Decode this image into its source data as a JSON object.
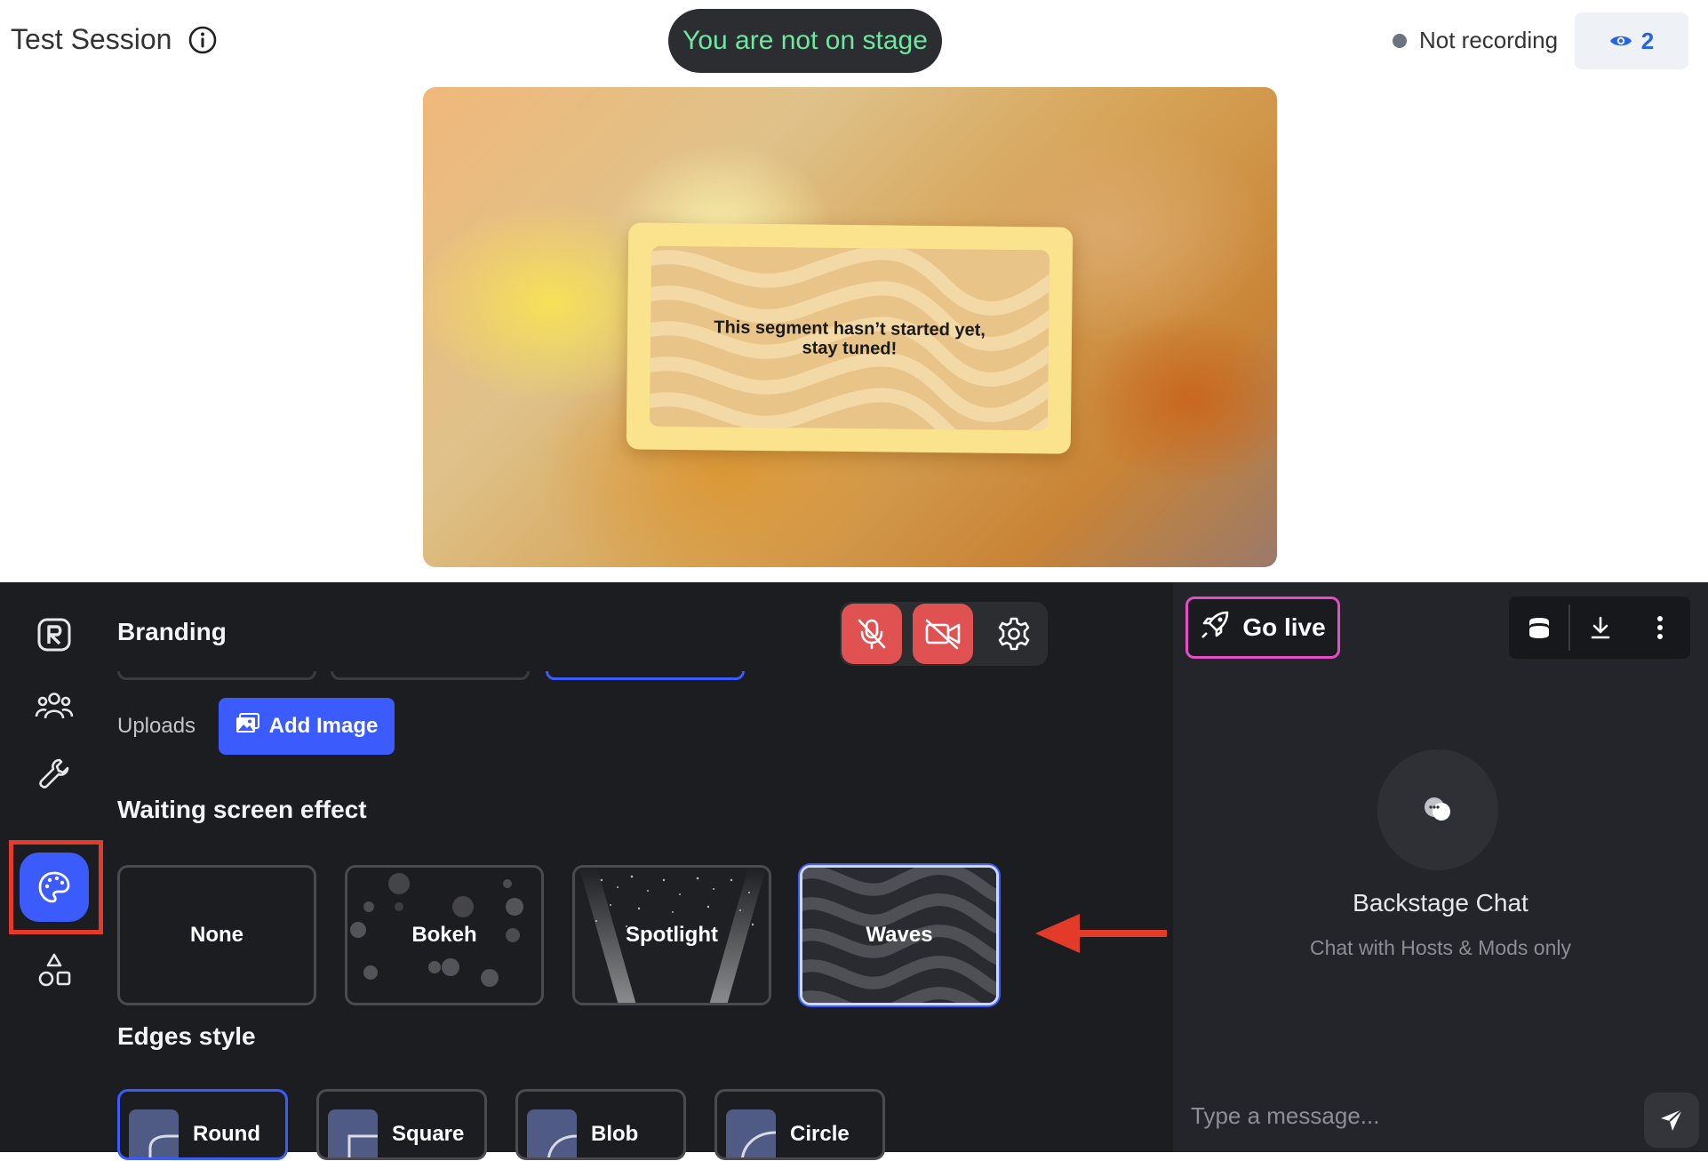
{
  "header": {
    "session_title": "Test Session",
    "info_icon": "info-icon",
    "stage_status": "You are not on stage",
    "recording_status": "Not recording",
    "viewer_count": "2",
    "viewer_icon": "eye-icon"
  },
  "stage_preview": {
    "message_line1": "This segment hasn’t started yet,",
    "message_line2": "stay tuned!"
  },
  "sidebar": {
    "items": [
      {
        "name": "logo-icon"
      },
      {
        "name": "people-icon"
      },
      {
        "name": "wrench-icon"
      },
      {
        "name": "palette-icon",
        "active": true
      },
      {
        "name": "shapes-icon"
      }
    ]
  },
  "branding": {
    "title": "Branding",
    "uploads_label": "Uploads",
    "add_image_label": "Add Image",
    "waiting_effect_title": "Waiting screen effect",
    "effects": [
      {
        "label": "None",
        "selected": false
      },
      {
        "label": "Bokeh",
        "selected": false
      },
      {
        "label": "Spotlight",
        "selected": false
      },
      {
        "label": "Waves",
        "selected": true
      }
    ],
    "edges_title": "Edges style",
    "edges": [
      {
        "label": "Round",
        "selected": true
      },
      {
        "label": "Square",
        "selected": false
      },
      {
        "label": "Blob",
        "selected": false
      },
      {
        "label": "Circle",
        "selected": false
      }
    ]
  },
  "av_controls": {
    "mic": "mic-off-icon",
    "camera": "camera-off-icon",
    "settings": "gear-icon"
  },
  "chat": {
    "go_live_label": "Go live",
    "title": "Backstage Chat",
    "subtitle": "Chat with Hosts & Mods only",
    "input_placeholder": "Type a message..."
  },
  "colors": {
    "accent": "#3b5bfd",
    "stage_status_text": "#6ee7a0",
    "danger": "#e05252",
    "go_live_border": "#e44cc8",
    "annotation_red": "#e23b2a"
  }
}
